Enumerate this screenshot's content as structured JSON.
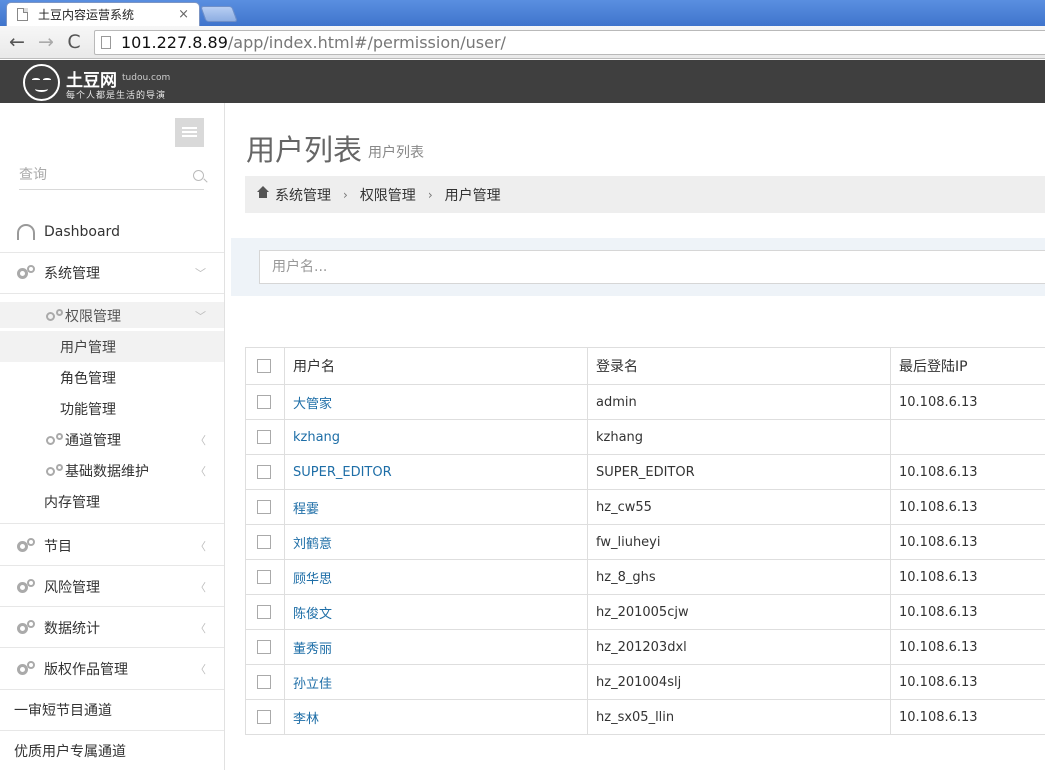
{
  "browser": {
    "tab_title": "土豆内容运营系统",
    "tab_close": "×",
    "url_host": "101.227.8.89",
    "url_path": "/app/index.html#/permission/user/",
    "back": "←",
    "forward": "→",
    "reload": "C"
  },
  "header": {
    "brand_name": "土豆网",
    "brand_domain": "tudou.com",
    "slogan": "每个人都是生活的导演"
  },
  "sidebar": {
    "search_placeholder": "查询",
    "dashboard": "Dashboard",
    "system": "系统管理",
    "permission": "权限管理",
    "user_mgmt": "用户管理",
    "role_mgmt": "角色管理",
    "func_mgmt": "功能管理",
    "channel_mgmt": "通道管理",
    "basic_data": "基础数据维护",
    "memory_mgmt": "内存管理",
    "programs": "节目",
    "risk_mgmt": "风险管理",
    "statistics": "数据统计",
    "copyright": "版权作品管理",
    "short_channel": "一审短节目通道",
    "vip_channel": "优质用户专属通道",
    "arrow_down": "﹀",
    "arrow_left": "〈"
  },
  "main": {
    "title": "用户列表",
    "subtitle": "用户列表",
    "breadcrumb": [
      "系统管理",
      "权限管理",
      "用户管理"
    ],
    "breadcrumb_sep": "›",
    "filter_placeholder": "用户名...",
    "table": {
      "headers": [
        "用户名",
        "登录名",
        "最后登陆IP"
      ],
      "rows": [
        [
          "大管家",
          "admin",
          "10.108.6.13"
        ],
        [
          "kzhang",
          "kzhang",
          ""
        ],
        [
          "SUPER_EDITOR",
          "SUPER_EDITOR",
          "10.108.6.13"
        ],
        [
          "程霎",
          "hz_cw55",
          "10.108.6.13"
        ],
        [
          "刘鹤意",
          "fw_liuheyi",
          "10.108.6.13"
        ],
        [
          "顾华思",
          "hz_8_ghs",
          "10.108.6.13"
        ],
        [
          "陈俊文",
          "hz_201005cjw",
          "10.108.6.13"
        ],
        [
          "董秀丽",
          "hz_201203dxl",
          "10.108.6.13"
        ],
        [
          "孙立佳",
          "hz_201004slj",
          "10.108.6.13"
        ],
        [
          "李林",
          "hz_sx05_llin",
          "10.108.6.13"
        ]
      ]
    }
  }
}
